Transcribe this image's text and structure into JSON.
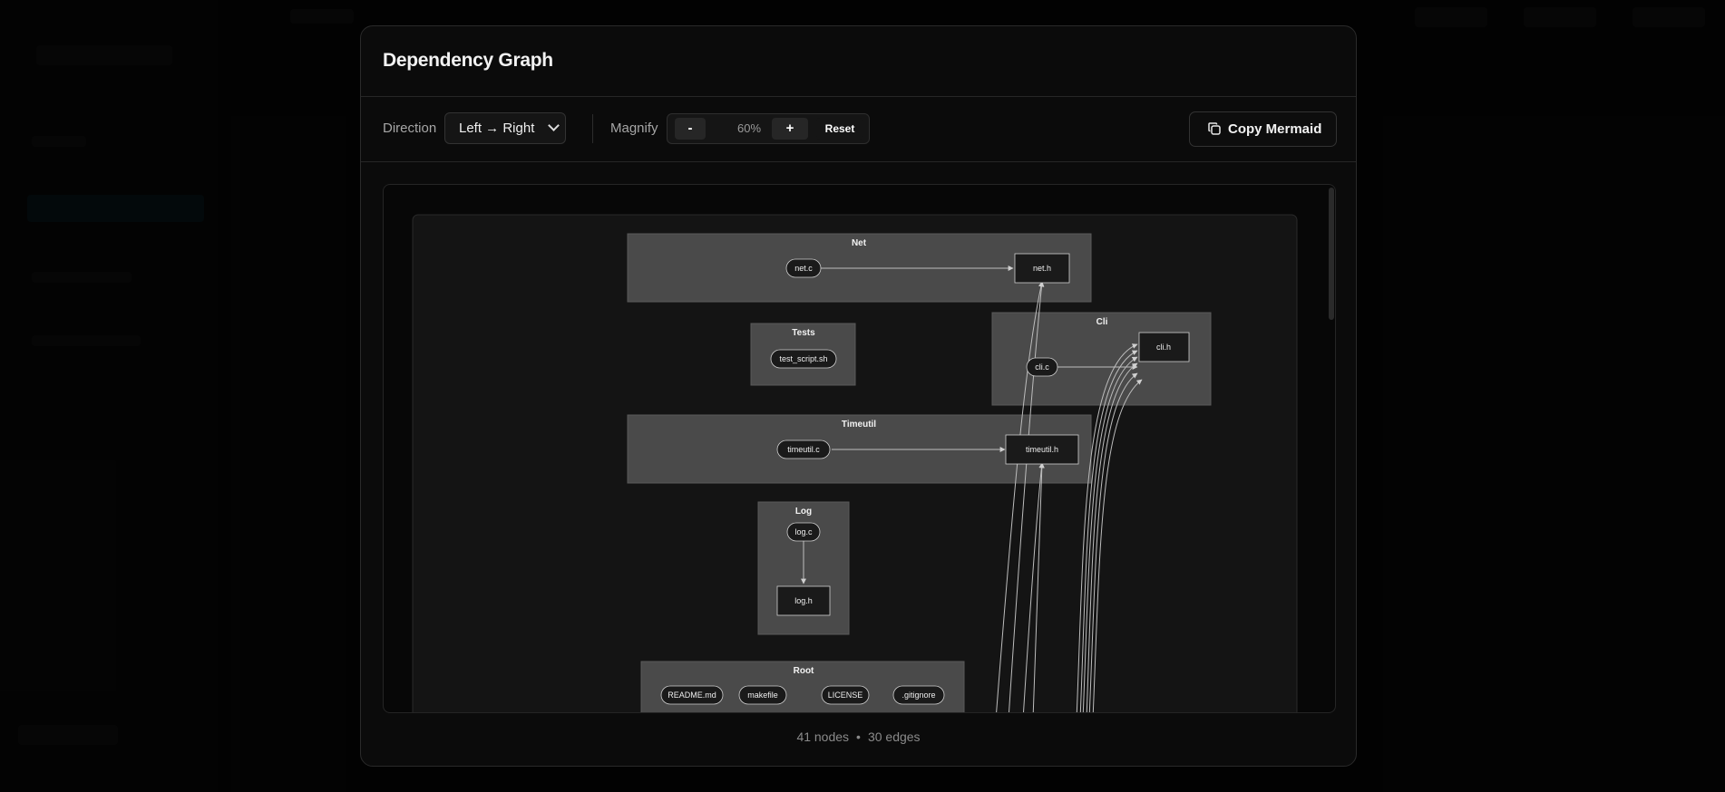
{
  "modal": {
    "title": "Dependency Graph"
  },
  "toolbar": {
    "direction_label": "Direction",
    "direction_value": "Left → Right",
    "magnify_label": "Magnify",
    "zoom_out_label": "-",
    "zoom_value": "60%",
    "zoom_in_label": "+",
    "reset_label": "Reset",
    "copy_label": "Copy Mermaid",
    "copy_icon": "copy-icon"
  },
  "graph": {
    "subgraphs": {
      "net": "Net",
      "tests": "Tests",
      "cli": "Cli",
      "timeutil": "Timeutil",
      "log": "Log",
      "root": "Root"
    },
    "nodes": {
      "net_c": "net.c",
      "net_h": "net.h",
      "test_script": "test_script.sh",
      "cli_c": "cli.c",
      "cli_h": "cli.h",
      "timeutil_c": "timeutil.c",
      "timeutil_h": "timeutil.h",
      "log_c": "log.c",
      "log_h": "log.h",
      "readme": "README.md",
      "makefile": "makefile",
      "license": "LICENSE",
      "gitignore": ".gitignore"
    }
  },
  "footer": {
    "nodes": "41 nodes",
    "separator": "•",
    "edges": "30 edges"
  },
  "colors": {
    "background": "#050505",
    "modal": "#0b0b0b",
    "subgraph_fill": "#4a4a4a",
    "node_fill": "#1a1a1a",
    "edge": "#bdbdbd"
  }
}
